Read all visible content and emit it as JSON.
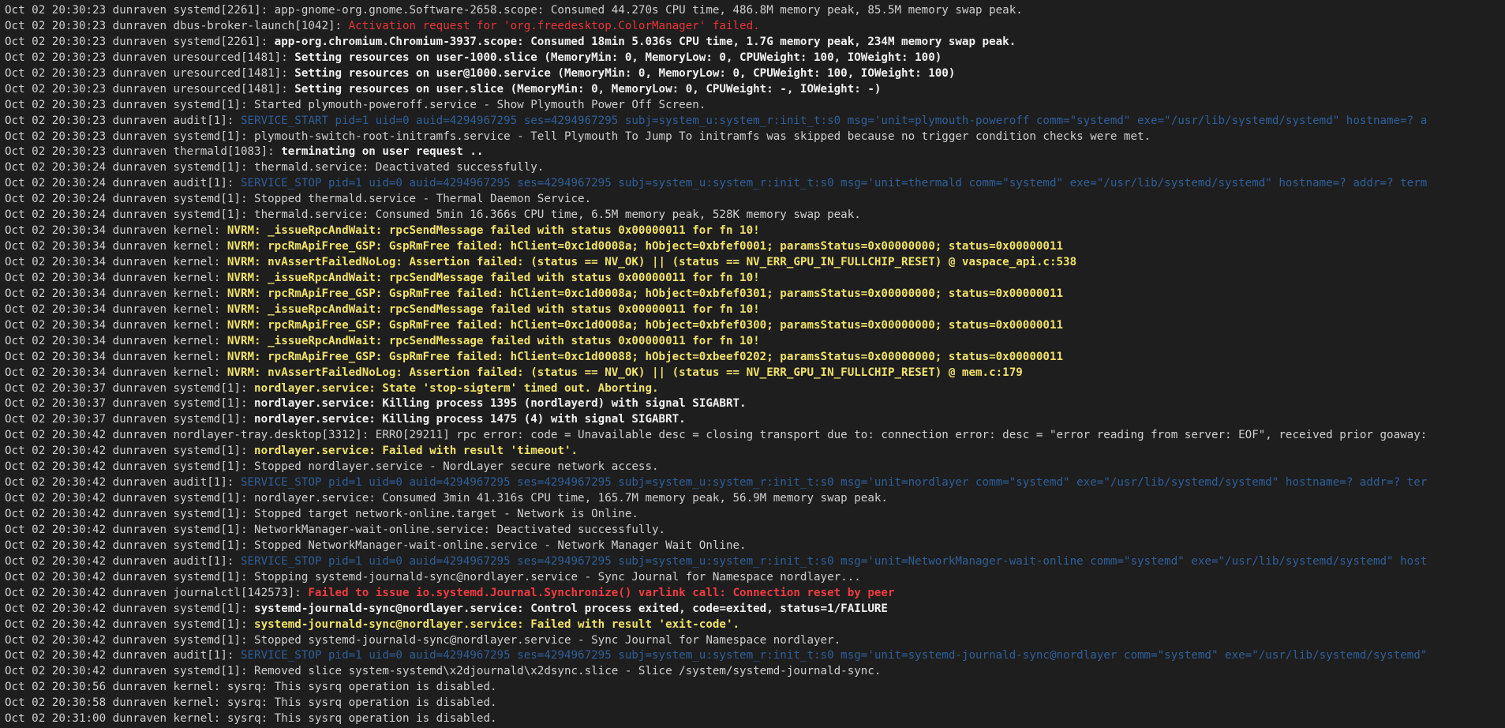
{
  "colors": {
    "background": "#1e1e1e",
    "normal": "#d0d0d0",
    "bold": "#f2f2f2",
    "error_red": "#e8353b",
    "warning_yellow": "#f0e26a",
    "audit_blue": "#2f5f9a"
  },
  "lines": [
    {
      "prefix": "Oct 02 20:30:23 dunraven systemd[2261]: ",
      "msg": "app-gnome-org.gnome.Software-2658.scope: Consumed 44.270s CPU time, 486.8M memory peak, 85.5M memory swap peak.",
      "style": "normal"
    },
    {
      "prefix": "Oct 02 20:30:23 dunraven dbus-broker-launch[1042]: ",
      "msg": "Activation request for 'org.freedesktop.ColorManager' failed.",
      "style": "red"
    },
    {
      "prefix": "Oct 02 20:30:23 dunraven systemd[2261]: ",
      "msg": "app-org.chromium.Chromium-3937.scope: Consumed 18min 5.036s CPU time, 1.7G memory peak, 234M memory swap peak.",
      "style": "bold"
    },
    {
      "prefix": "Oct 02 20:30:23 dunraven uresourced[1481]: ",
      "msg": "Setting resources on user-1000.slice (MemoryMin: 0, MemoryLow: 0, CPUWeight: 100, IOWeight: 100)",
      "style": "bold"
    },
    {
      "prefix": "Oct 02 20:30:23 dunraven uresourced[1481]: ",
      "msg": "Setting resources on user@1000.service (MemoryMin: 0, MemoryLow: 0, CPUWeight: 100, IOWeight: 100)",
      "style": "bold"
    },
    {
      "prefix": "Oct 02 20:30:23 dunraven uresourced[1481]: ",
      "msg": "Setting resources on user.slice (MemoryMin: 0, MemoryLow: 0, CPUWeight: -, IOWeight: -)",
      "style": "bold"
    },
    {
      "prefix": "Oct 02 20:30:23 dunraven systemd[1]: ",
      "msg": "Started plymouth-poweroff.service - Show Plymouth Power Off Screen.",
      "style": "normal"
    },
    {
      "prefix": "Oct 02 20:30:23 dunraven audit[1]: ",
      "msg": "SERVICE_START pid=1 uid=0 auid=4294967295 ses=4294967295 subj=system_u:system_r:init_t:s0 msg='unit=plymouth-poweroff comm=\"systemd\" exe=\"/usr/lib/systemd/systemd\" hostname=? a",
      "style": "audit"
    },
    {
      "prefix": "Oct 02 20:30:23 dunraven systemd[1]: ",
      "msg": "plymouth-switch-root-initramfs.service - Tell Plymouth To Jump To initramfs was skipped because no trigger condition checks were met.",
      "style": "normal"
    },
    {
      "prefix": "Oct 02 20:30:23 dunraven thermald[1083]: ",
      "msg": "terminating on user request ..",
      "style": "bold"
    },
    {
      "prefix": "Oct 02 20:30:24 dunraven systemd[1]: ",
      "msg": "thermald.service: Deactivated successfully.",
      "style": "normal"
    },
    {
      "prefix": "Oct 02 20:30:24 dunraven audit[1]: ",
      "msg": "SERVICE_STOP pid=1 uid=0 auid=4294967295 ses=4294967295 subj=system_u:system_r:init_t:s0 msg='unit=thermald comm=\"systemd\" exe=\"/usr/lib/systemd/systemd\" hostname=? addr=? term",
      "style": "audit"
    },
    {
      "prefix": "Oct 02 20:30:24 dunraven systemd[1]: ",
      "msg": "Stopped thermald.service - Thermal Daemon Service.",
      "style": "normal"
    },
    {
      "prefix": "Oct 02 20:30:24 dunraven systemd[1]: ",
      "msg": "thermald.service: Consumed 5min 16.366s CPU time, 6.5M memory peak, 528K memory swap peak.",
      "style": "normal"
    },
    {
      "prefix": "Oct 02 20:30:34 dunraven kernel: ",
      "msg": "NVRM: _issueRpcAndWait: rpcSendMessage failed with status 0x00000011 for fn 10!",
      "style": "yellow"
    },
    {
      "prefix": "Oct 02 20:30:34 dunraven kernel: ",
      "msg": "NVRM: rpcRmApiFree_GSP: GspRmFree failed: hClient=0xc1d0008a; hObject=0xbfef0001; paramsStatus=0x00000000; status=0x00000011",
      "style": "yellow"
    },
    {
      "prefix": "Oct 02 20:30:34 dunraven kernel: ",
      "msg": "NVRM: nvAssertFailedNoLog: Assertion failed: (status == NV_OK) || (status == NV_ERR_GPU_IN_FULLCHIP_RESET) @ vaspace_api.c:538",
      "style": "yellow"
    },
    {
      "prefix": "Oct 02 20:30:34 dunraven kernel: ",
      "msg": "NVRM: _issueRpcAndWait: rpcSendMessage failed with status 0x00000011 for fn 10!",
      "style": "yellow"
    },
    {
      "prefix": "Oct 02 20:30:34 dunraven kernel: ",
      "msg": "NVRM: rpcRmApiFree_GSP: GspRmFree failed: hClient=0xc1d0008a; hObject=0xbfef0301; paramsStatus=0x00000000; status=0x00000011",
      "style": "yellow"
    },
    {
      "prefix": "Oct 02 20:30:34 dunraven kernel: ",
      "msg": "NVRM: _issueRpcAndWait: rpcSendMessage failed with status 0x00000011 for fn 10!",
      "style": "yellow"
    },
    {
      "prefix": "Oct 02 20:30:34 dunraven kernel: ",
      "msg": "NVRM: rpcRmApiFree_GSP: GspRmFree failed: hClient=0xc1d0008a; hObject=0xbfef0300; paramsStatus=0x00000000; status=0x00000011",
      "style": "yellow"
    },
    {
      "prefix": "Oct 02 20:30:34 dunraven kernel: ",
      "msg": "NVRM: _issueRpcAndWait: rpcSendMessage failed with status 0x00000011 for fn 10!",
      "style": "yellow"
    },
    {
      "prefix": "Oct 02 20:30:34 dunraven kernel: ",
      "msg": "NVRM: rpcRmApiFree_GSP: GspRmFree failed: hClient=0xc1d00088; hObject=0xbeef0202; paramsStatus=0x00000000; status=0x00000011",
      "style": "yellow"
    },
    {
      "prefix": "Oct 02 20:30:34 dunraven kernel: ",
      "msg": "NVRM: nvAssertFailedNoLog: Assertion failed: (status == NV_OK) || (status == NV_ERR_GPU_IN_FULLCHIP_RESET) @ mem.c:179",
      "style": "yellow"
    },
    {
      "prefix": "Oct 02 20:30:37 dunraven systemd[1]: ",
      "msg": "nordlayer.service: State 'stop-sigterm' timed out. Aborting.",
      "style": "yellow"
    },
    {
      "prefix": "Oct 02 20:30:37 dunraven systemd[1]: ",
      "msg": "nordlayer.service: Killing process 1395 (nordlayerd) with signal SIGABRT.",
      "style": "bold"
    },
    {
      "prefix": "Oct 02 20:30:37 dunraven systemd[1]: ",
      "msg": "nordlayer.service: Killing process 1475 (4) with signal SIGABRT.",
      "style": "bold"
    },
    {
      "prefix": "Oct 02 20:30:42 dunraven nordlayer-tray.desktop[3312]: ",
      "msg": "ERRO[29211] rpc error: code = Unavailable desc = closing transport due to: connection error: desc = \"error reading from server: EOF\", received prior goaway:",
      "style": "normal"
    },
    {
      "prefix": "Oct 02 20:30:42 dunraven systemd[1]: ",
      "msg": "nordlayer.service: Failed with result 'timeout'.",
      "style": "yellow"
    },
    {
      "prefix": "Oct 02 20:30:42 dunraven systemd[1]: ",
      "msg": "Stopped nordlayer.service - NordLayer secure network access.",
      "style": "normal"
    },
    {
      "prefix": "Oct 02 20:30:42 dunraven audit[1]: ",
      "msg": "SERVICE_STOP pid=1 uid=0 auid=4294967295 ses=4294967295 subj=system_u:system_r:init_t:s0 msg='unit=nordlayer comm=\"systemd\" exe=\"/usr/lib/systemd/systemd\" hostname=? addr=? ter",
      "style": "audit"
    },
    {
      "prefix": "Oct 02 20:30:42 dunraven systemd[1]: ",
      "msg": "nordlayer.service: Consumed 3min 41.316s CPU time, 165.7M memory peak, 56.9M memory swap peak.",
      "style": "normal"
    },
    {
      "prefix": "Oct 02 20:30:42 dunraven systemd[1]: ",
      "msg": "Stopped target network-online.target - Network is Online.",
      "style": "normal"
    },
    {
      "prefix": "Oct 02 20:30:42 dunraven systemd[1]: ",
      "msg": "NetworkManager-wait-online.service: Deactivated successfully.",
      "style": "normal"
    },
    {
      "prefix": "Oct 02 20:30:42 dunraven systemd[1]: ",
      "msg": "Stopped NetworkManager-wait-online.service - Network Manager Wait Online.",
      "style": "normal"
    },
    {
      "prefix": "Oct 02 20:30:42 dunraven audit[1]: ",
      "msg": "SERVICE_STOP pid=1 uid=0 auid=4294967295 ses=4294967295 subj=system_u:system_r:init_t:s0 msg='unit=NetworkManager-wait-online comm=\"systemd\" exe=\"/usr/lib/systemd/systemd\" host",
      "style": "audit"
    },
    {
      "prefix": "Oct 02 20:30:42 dunraven systemd[1]: ",
      "msg": "Stopping systemd-journald-sync@nordlayer.service - Sync Journal for Namespace nordlayer...",
      "style": "normal"
    },
    {
      "prefix": "Oct 02 20:30:42 dunraven journalctl[142573]: ",
      "msg": "Failed to issue io.systemd.Journal.Synchronize() varlink call: Connection reset by peer",
      "style": "redbold"
    },
    {
      "prefix": "Oct 02 20:30:42 dunraven systemd[1]: ",
      "msg": "systemd-journald-sync@nordlayer.service: Control process exited, code=exited, status=1/FAILURE",
      "style": "bold"
    },
    {
      "prefix": "Oct 02 20:30:42 dunraven systemd[1]: ",
      "msg": "systemd-journald-sync@nordlayer.service: Failed with result 'exit-code'.",
      "style": "yellow"
    },
    {
      "prefix": "Oct 02 20:30:42 dunraven systemd[1]: ",
      "msg": "Stopped systemd-journald-sync@nordlayer.service - Sync Journal for Namespace nordlayer.",
      "style": "normal"
    },
    {
      "prefix": "Oct 02 20:30:42 dunraven audit[1]: ",
      "msg": "SERVICE_STOP pid=1 uid=0 auid=4294967295 ses=4294967295 subj=system_u:system_r:init_t:s0 msg='unit=systemd-journald-sync@nordlayer comm=\"systemd\" exe=\"/usr/lib/systemd/systemd\"",
      "style": "audit"
    },
    {
      "prefix": "Oct 02 20:30:42 dunraven systemd[1]: ",
      "msg": "Removed slice system-systemd\\x2djournald\\x2dsync.slice - Slice /system/systemd-journald-sync.",
      "style": "normal"
    },
    {
      "prefix": "Oct 02 20:30:56 dunraven kernel: ",
      "msg": "sysrq: This sysrq operation is disabled.",
      "style": "normal"
    },
    {
      "prefix": "Oct 02 20:30:58 dunraven kernel: ",
      "msg": "sysrq: This sysrq operation is disabled.",
      "style": "normal"
    },
    {
      "prefix": "Oct 02 20:31:00 dunraven kernel: ",
      "msg": "sysrq: This sysrq operation is disabled.",
      "style": "normal"
    }
  ]
}
